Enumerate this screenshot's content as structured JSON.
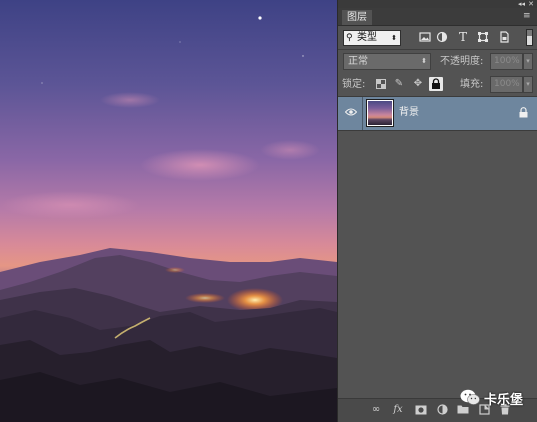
{
  "panel": {
    "collapse_icon": "double-chevron-right",
    "close_icon": "close-x",
    "tab_label": "图层",
    "menu_icon": "panel-menu"
  },
  "filter": {
    "kind_label": "类型",
    "icons": [
      "image-layer-filter",
      "adjustment-layer-filter",
      "type-layer-filter",
      "shape-layer-filter",
      "smart-object-filter"
    ]
  },
  "blend": {
    "mode": "正常",
    "opacity_label": "不透明度:",
    "opacity_value": "100%"
  },
  "lock": {
    "label": "锁定:",
    "fill_label": "填充:",
    "fill_value": "100%"
  },
  "layers": [
    {
      "name": "背景",
      "visible": true,
      "locked": true
    }
  ],
  "bottom_icons": [
    "link",
    "fx",
    "mask",
    "adjustment",
    "group",
    "new-layer",
    "delete"
  ],
  "watermark": {
    "text": "卡乐堡"
  },
  "colors": {
    "panel_bg": "#535353",
    "selected_layer": "#6e869e"
  }
}
